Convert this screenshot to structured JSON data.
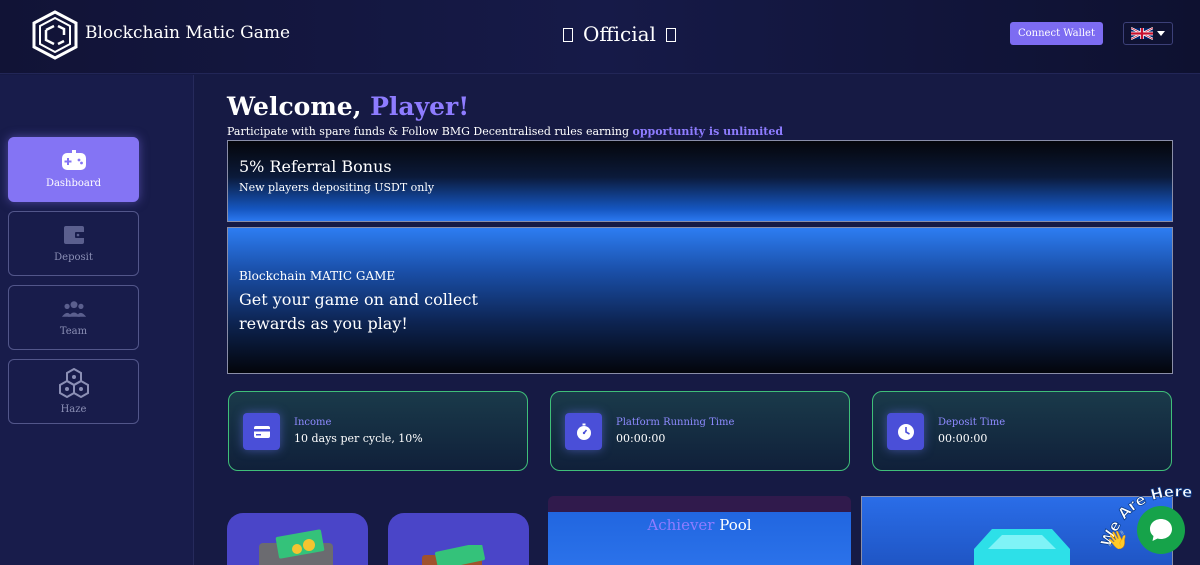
{
  "header": {
    "brand": "Blockchain Matic Game",
    "official": "Official",
    "connect_label": "Connect Wallet",
    "language": "English (UK flag)"
  },
  "sidebar": {
    "items": [
      {
        "label": "Dashboard",
        "icon": "gamepad-icon",
        "active": true
      },
      {
        "label": "Deposit",
        "icon": "wallet-icon",
        "active": false
      },
      {
        "label": "Team",
        "icon": "team-icon",
        "active": false
      },
      {
        "label": "Haze",
        "icon": "haze-icon",
        "active": false
      }
    ]
  },
  "welcome": {
    "prefix": "Welcome,",
    "name": "Player!",
    "sub_prefix": "Participate with spare funds & Follow BMG Decentralised rules earning",
    "sub_highlight": "opportunity is unlimited"
  },
  "banner_referral": {
    "title": "5% Referral Bonus",
    "text": "New players depositing USDT only"
  },
  "banner_game": {
    "title": "Blockchain MATIC GAME",
    "text": "Get your game on and collect rewards as you play!"
  },
  "stats": [
    {
      "label": "Income",
      "value": "10 days per cycle, 10%",
      "icon": "card-icon"
    },
    {
      "label": "Platform Running Time",
      "value": "00:00:00",
      "icon": "stopwatch-icon"
    },
    {
      "label": "Deposit Time",
      "value": "00:00:00",
      "icon": "clock-icon"
    }
  ],
  "pool": {
    "word1": "Achiever",
    "word2": "Pool"
  },
  "chat": {
    "badge": "We Are Here!"
  },
  "colors": {
    "accent": "#8474f4",
    "stat_border": "#3fbf79",
    "chat": "#16a34a"
  }
}
